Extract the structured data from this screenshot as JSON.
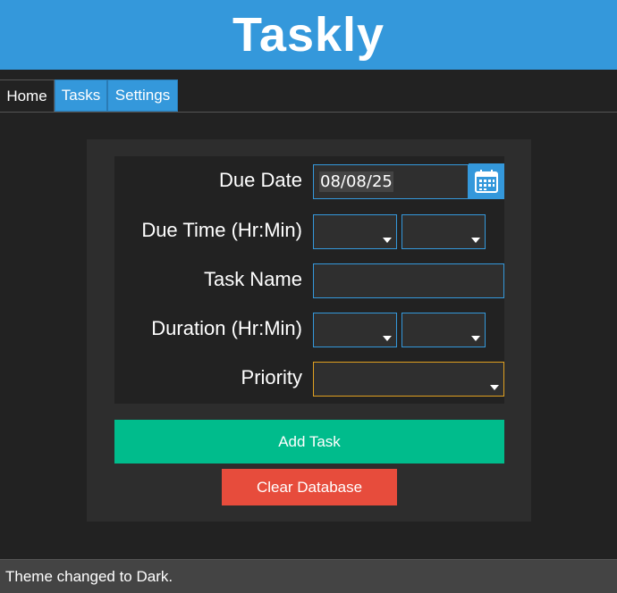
{
  "app": {
    "title": "Taskly"
  },
  "tabs": [
    {
      "label": "Home",
      "active": true
    },
    {
      "label": "Tasks",
      "active": false
    },
    {
      "label": "Settings",
      "active": false
    }
  ],
  "form": {
    "due_date": {
      "label": "Due Date",
      "value": "08/08/25",
      "icon": "calendar-icon"
    },
    "due_time": {
      "label": "Due Time (Hr:Min)",
      "hour": "",
      "minute": ""
    },
    "task_name": {
      "label": "Task Name",
      "value": ""
    },
    "duration": {
      "label": "Duration (Hr:Min)",
      "hour": "",
      "minute": ""
    },
    "priority": {
      "label": "Priority",
      "value": ""
    }
  },
  "buttons": {
    "add_task": "Add Task",
    "clear_database": "Clear Database"
  },
  "status": {
    "text": "Theme changed to Dark."
  },
  "colors": {
    "header": "#3498db",
    "background": "#222222",
    "add_button": "#00bc8c",
    "clear_button": "#e74c3c",
    "field_border": "#3498db",
    "priority_border": "#e0a020"
  }
}
